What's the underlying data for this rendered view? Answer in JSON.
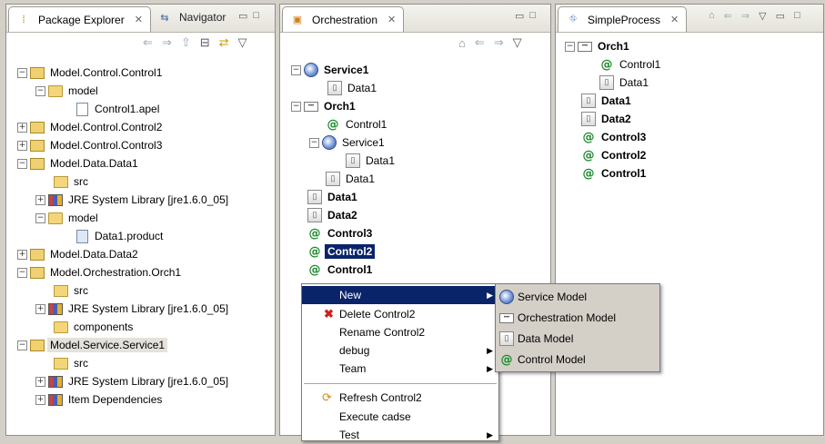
{
  "package_explorer": {
    "tab_label": "Package Explorer",
    "tab2_label": "Navigator",
    "items": [
      {
        "label": "Model.Control.Control1"
      },
      {
        "label": "model"
      },
      {
        "label": "Control1.apel"
      },
      {
        "label": "Model.Control.Control2"
      },
      {
        "label": "Model.Control.Control3"
      },
      {
        "label": "Model.Data.Data1"
      },
      {
        "label": "src"
      },
      {
        "label": "JRE System Library [jre1.6.0_05]"
      },
      {
        "label": "model"
      },
      {
        "label": "Data1.product"
      },
      {
        "label": "Model.Data.Data2"
      },
      {
        "label": "Model.Orchestration.Orch1"
      },
      {
        "label": "src"
      },
      {
        "label": "JRE System Library [jre1.6.0_05]"
      },
      {
        "label": "components"
      },
      {
        "label": "Model.Service.Service1"
      },
      {
        "label": "src"
      },
      {
        "label": "JRE System Library [jre1.6.0_05]"
      },
      {
        "label": "Item Dependencies"
      }
    ]
  },
  "orchestration": {
    "tab_label": "Orchestration",
    "items": [
      {
        "label": "Service1"
      },
      {
        "label": "Data1"
      },
      {
        "label": "Orch1"
      },
      {
        "label": "Control1"
      },
      {
        "label": "Service1"
      },
      {
        "label": "Data1"
      },
      {
        "label": "Data1"
      },
      {
        "label": "Data1"
      },
      {
        "label": "Data2"
      },
      {
        "label": "Control3"
      },
      {
        "label": "Control2"
      },
      {
        "label": "Control1"
      }
    ]
  },
  "simple_process": {
    "tab_label": "SimpleProcess",
    "items": [
      {
        "label": "Orch1"
      },
      {
        "label": "Control1"
      },
      {
        "label": "Data1"
      },
      {
        "label": "Data1"
      },
      {
        "label": "Data2"
      },
      {
        "label": "Control3"
      },
      {
        "label": "Control2"
      },
      {
        "label": "Control1"
      }
    ]
  },
  "context_menu": {
    "items": [
      {
        "label": "New"
      },
      {
        "label": "Delete Control2"
      },
      {
        "label": "Rename Control2"
      },
      {
        "label": "debug"
      },
      {
        "label": "Team"
      },
      {
        "label": "Refresh Control2"
      },
      {
        "label": "Execute cadse"
      },
      {
        "label": "Test"
      }
    ]
  },
  "new_submenu": {
    "items": [
      {
        "label": "Service Model"
      },
      {
        "label": "Orchestration Model"
      },
      {
        "label": "Data Model"
      },
      {
        "label": "Control Model"
      }
    ]
  }
}
